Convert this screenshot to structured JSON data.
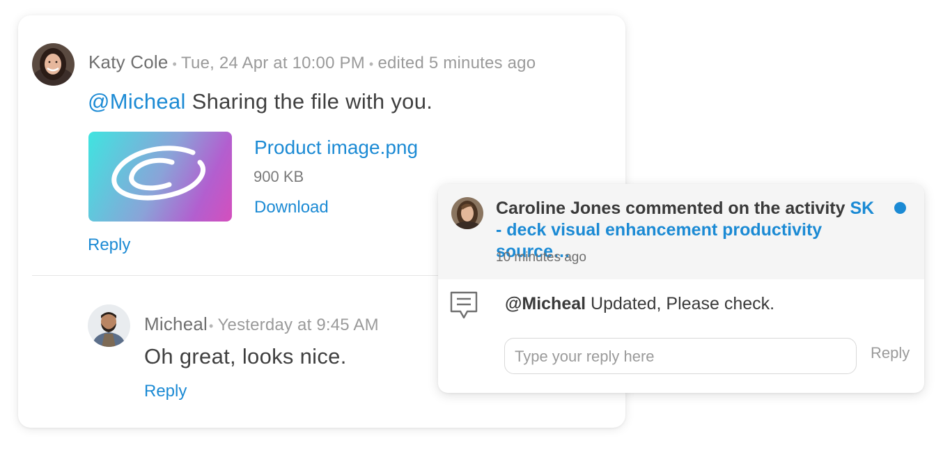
{
  "thread": {
    "comment": {
      "author": "Katy Cole",
      "timestamp": "Tue, 24 Apr at 10:00 PM",
      "edited": "edited 5 minutes ago",
      "mention": "@Micheal",
      "text": " Sharing the file with you.",
      "attachment": {
        "name": "Product image.png",
        "size": "900 KB",
        "download_label": "Download"
      },
      "reply_label": "Reply"
    },
    "reply": {
      "author": "Micheal",
      "timestamp": "Yesterday at 9:45 AM",
      "text": "Oh great, looks nice.",
      "reply_label": "Reply"
    }
  },
  "notification": {
    "actor_text": "Caroline Jones commented on the activity ",
    "activity": "SK - deck visual enhancement productivity source…",
    "time": "10 minutes ago",
    "comment_mention": "@Micheal",
    "comment_text": " Updated, Please check.",
    "reply_placeholder": "Type your reply here",
    "reply_button": "Reply"
  },
  "colors": {
    "accent": "#1b8ad4",
    "unread": "#1b8ad4"
  },
  "icons": {
    "comment": "comment-bubble-icon"
  }
}
